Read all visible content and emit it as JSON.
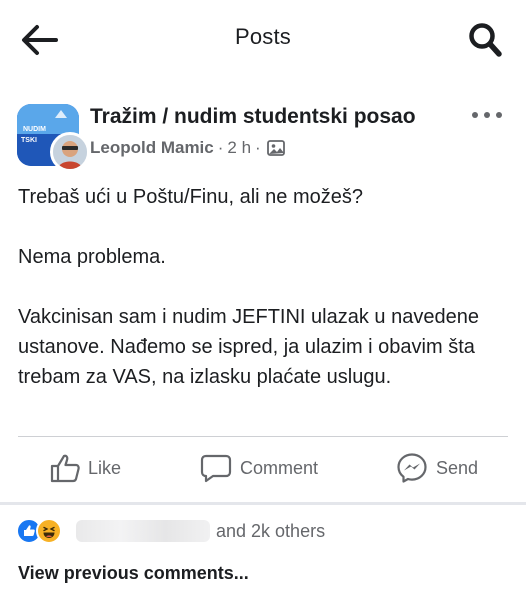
{
  "header": {
    "title": "Posts",
    "back_icon": "arrow-left-icon",
    "search_icon": "search-icon"
  },
  "post": {
    "group_name": "Tražim / nudim studentski posao",
    "group_avatar_text": [
      "NUDIM",
      "TSKI"
    ],
    "author": "Leopold Mamic",
    "time": "2 h",
    "separator": "·",
    "privacy_icon": "photo-icon",
    "more_icon": "more-horizontal-icon",
    "paragraphs": [
      "Trebaš ući u Poštu/Finu, ali ne možeš?",
      "Nema problema.",
      "Vakcinisan sam i nudim JEFTINI ulazak u navedene ustanove. Nađemo se ispred, ja ulazim i obavim šta trebam za VAS, na izlasku plaćate uslugu."
    ]
  },
  "actions": {
    "like": "Like",
    "comment": "Comment",
    "send": "Send"
  },
  "reactions": {
    "icons": [
      "like-reaction-icon",
      "haha-reaction-icon"
    ],
    "others": "and 2k others"
  },
  "comments": {
    "view_previous": "View previous comments..."
  },
  "colors": {
    "like_blue": "#1877f2",
    "haha_yellow": "#f7b125",
    "secondary_text": "#65676b",
    "primary_text": "#1c1e21"
  }
}
